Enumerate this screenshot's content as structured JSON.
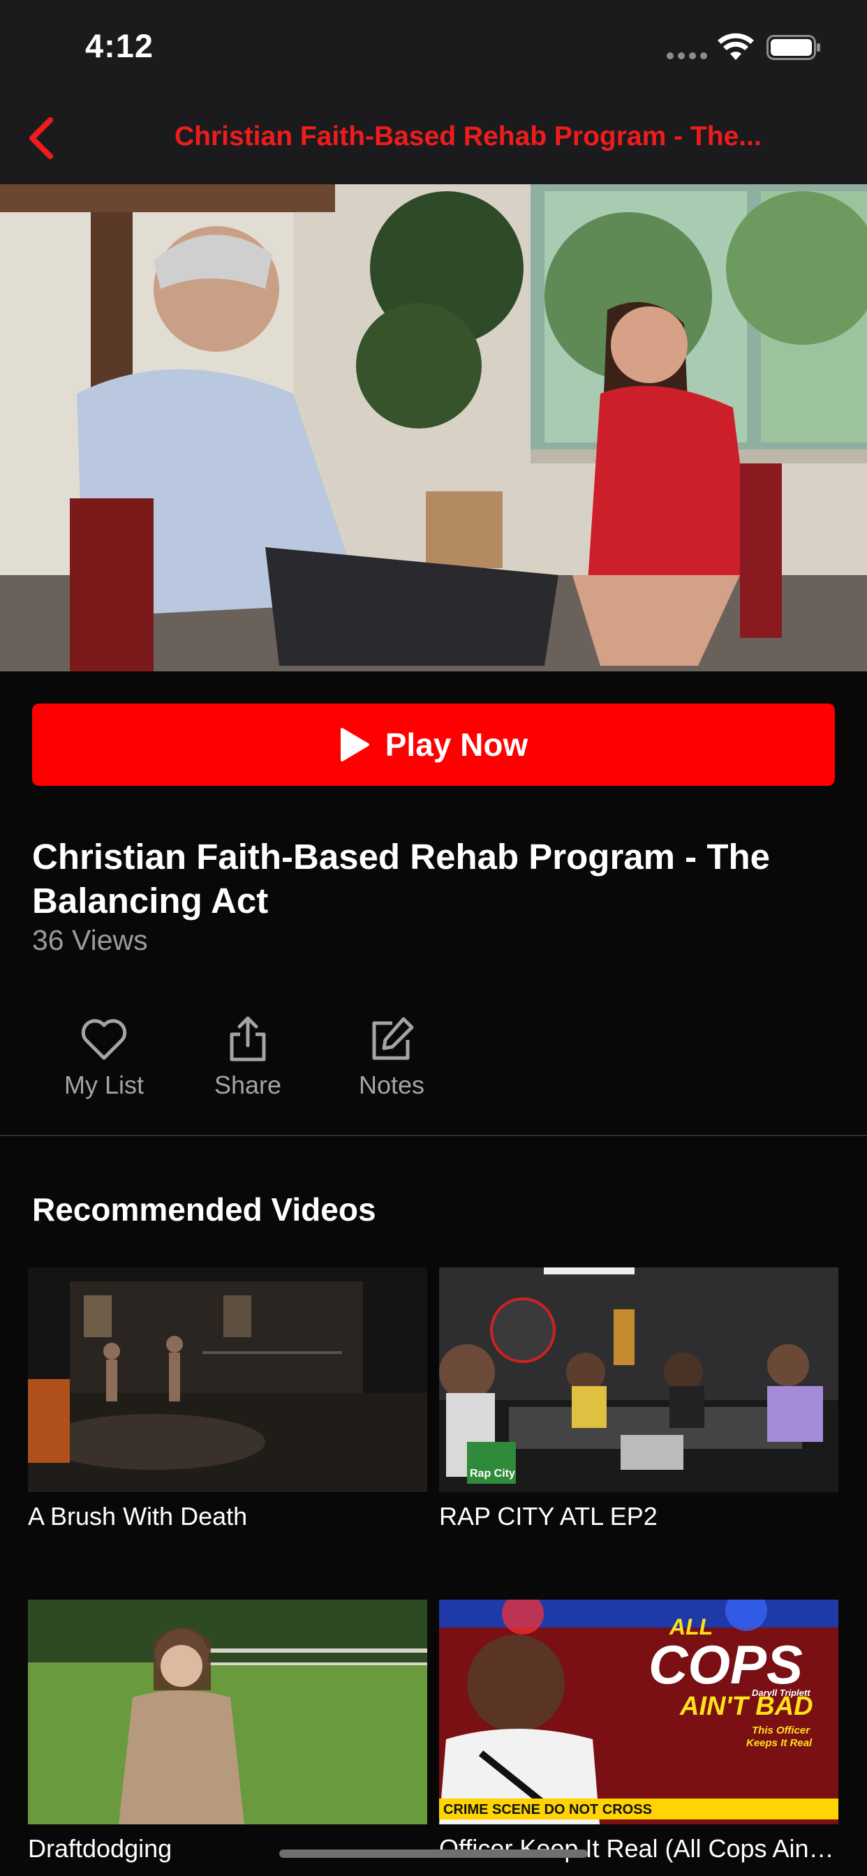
{
  "status_bar": {
    "time": "4:12"
  },
  "nav": {
    "title": "Christian Faith-Based Rehab Program - The..."
  },
  "video": {
    "play_label": "Play Now",
    "title": "Christian Faith-Based Rehab Program - The Balancing Act",
    "views": "36 Views"
  },
  "actions": [
    {
      "label": "My List",
      "icon": "heart-icon"
    },
    {
      "label": "Share",
      "icon": "share-icon"
    },
    {
      "label": "Notes",
      "icon": "edit-icon"
    }
  ],
  "recommended": {
    "title": "Recommended Videos",
    "items": [
      {
        "title": "A Brush With Death"
      },
      {
        "title": "RAP CITY ATL EP2"
      },
      {
        "title": "Draftdodging"
      },
      {
        "title": "Officer Keep It Real (All Cops Ain't Bad)"
      }
    ],
    "poster_text": {
      "line1": "ALL",
      "line2": "COPS",
      "line3": "AIN'T BAD",
      "name": "Daryll Triplett",
      "tagline1": "This Officer",
      "tagline2": "Keeps It Real",
      "tape": "CRIME SCENE DO NOT CROSS"
    },
    "rap_city_logo": "Rap City"
  },
  "colors": {
    "accent": "#ff0000",
    "nav_title": "#ee1c1c",
    "background": "#080808",
    "bar": "#1b1b1d"
  }
}
